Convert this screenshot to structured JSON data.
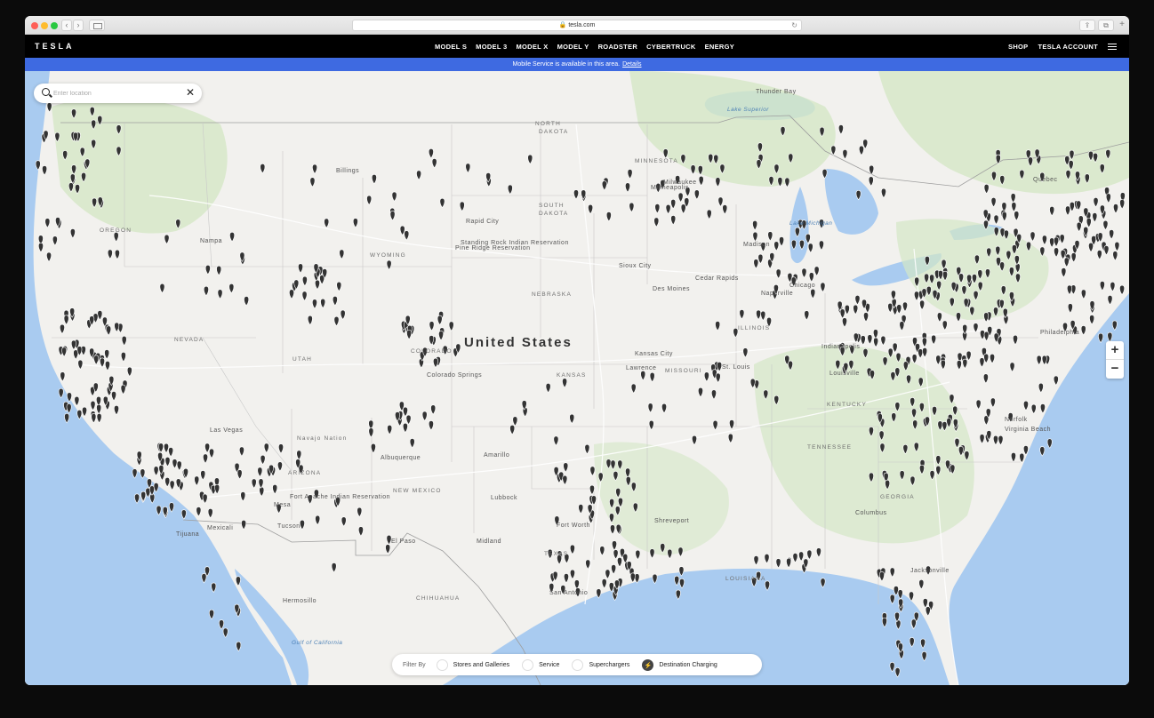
{
  "browser": {
    "url": "tesla.com",
    "reload_icon": "reload-icon",
    "back_glyph": "‹",
    "forward_glyph": "›",
    "share_glyph": "⇪",
    "tabs_glyph": "⧉",
    "newtab_glyph": "+"
  },
  "header": {
    "logo": "TESLA",
    "nav": [
      "MODEL S",
      "MODEL 3",
      "MODEL X",
      "MODEL Y",
      "ROADSTER",
      "CYBERTRUCK",
      "ENERGY"
    ],
    "shop": "SHOP",
    "account": "TESLA ACCOUNT"
  },
  "banner": {
    "text": "Mobile Service is available in this area.",
    "link": "Details"
  },
  "search": {
    "placeholder": "Enter location",
    "clear_glyph": "✕"
  },
  "zoom": {
    "in": "+",
    "out": "−"
  },
  "filter": {
    "label": "Filter By",
    "options": [
      {
        "label": "Stores and Galleries",
        "checked": false
      },
      {
        "label": "Service",
        "checked": false
      },
      {
        "label": "Superchargers",
        "checked": false
      },
      {
        "label": "Destination Charging",
        "checked": true,
        "icon": "bolt-icon"
      }
    ],
    "bolt_glyph": "⚡"
  },
  "map": {
    "country_label": "United States",
    "colors": {
      "land": "#f2f1ee",
      "water": "#a9cbf0",
      "forest": "#d4e7c6",
      "pin": "#333333"
    },
    "labels": [
      {
        "text": "NORTH",
        "type": "state"
      },
      {
        "text": "DAKOTA",
        "type": "state"
      },
      {
        "text": "SOUTH",
        "type": "state"
      },
      {
        "text": "DAKOTA",
        "type": "state"
      },
      {
        "text": "MINNESOTA",
        "type": "state"
      },
      {
        "text": "OREGON",
        "type": "state"
      },
      {
        "text": "WYOMING",
        "type": "state"
      },
      {
        "text": "NEBRASKA",
        "type": "state"
      },
      {
        "text": "NEVADA",
        "type": "state"
      },
      {
        "text": "KANSAS",
        "type": "state"
      },
      {
        "text": "MISSOURI",
        "type": "state"
      },
      {
        "text": "ILLINOIS",
        "type": "state"
      },
      {
        "text": "KENTUCKY",
        "type": "state"
      },
      {
        "text": "TENNESSEE",
        "type": "state"
      },
      {
        "text": "NEW MEXICO",
        "type": "state"
      },
      {
        "text": "ARIZONA",
        "type": "state"
      },
      {
        "text": "TEXAS",
        "type": "state"
      },
      {
        "text": "GEORGIA",
        "type": "state"
      },
      {
        "text": "LOUISIANA",
        "type": "state"
      },
      {
        "text": "CHIHUAHUA",
        "type": "state"
      },
      {
        "text": "UTAH",
        "type": "state"
      },
      {
        "text": "COLORADO",
        "type": "state"
      },
      {
        "text": "Lake Superior",
        "type": "water"
      },
      {
        "text": "Lake Michigan",
        "type": "water"
      },
      {
        "text": "Gulf of California",
        "type": "water"
      },
      {
        "text": "Las Vegas",
        "type": "city"
      },
      {
        "text": "Albuquerque",
        "type": "city"
      },
      {
        "text": "Fort Worth",
        "type": "city"
      },
      {
        "text": "Tucson",
        "type": "city"
      },
      {
        "text": "El Paso",
        "type": "city"
      },
      {
        "text": "San Antonio",
        "type": "city"
      },
      {
        "text": "Hermosillo",
        "type": "city"
      },
      {
        "text": "Louisville",
        "type": "city"
      },
      {
        "text": "Columbus",
        "type": "city"
      },
      {
        "text": "Jacksonville",
        "type": "city"
      },
      {
        "text": "Norfolk",
        "type": "city"
      },
      {
        "text": "Virginia Beach",
        "type": "city"
      },
      {
        "text": "Kansas City",
        "type": "city"
      },
      {
        "text": "St. Louis",
        "type": "city"
      },
      {
        "text": "Chicago",
        "type": "city"
      },
      {
        "text": "Des Moines",
        "type": "city"
      },
      {
        "text": "Minneapolis",
        "type": "city"
      },
      {
        "text": "Lubbock",
        "type": "city"
      },
      {
        "text": "Amarillo",
        "type": "city"
      },
      {
        "text": "Mesa",
        "type": "city"
      },
      {
        "text": "Mexicali",
        "type": "city"
      },
      {
        "text": "Tijuana",
        "type": "city"
      },
      {
        "text": "Billings",
        "type": "city"
      },
      {
        "text": "Nampa",
        "type": "city"
      },
      {
        "text": "Rapid City",
        "type": "city"
      },
      {
        "text": "Colorado Springs",
        "type": "city"
      },
      {
        "text": "Lawrence",
        "type": "city"
      },
      {
        "text": "Shreveport",
        "type": "city"
      },
      {
        "text": "Indianapolis",
        "type": "city"
      },
      {
        "text": "Midland",
        "type": "city"
      },
      {
        "text": "Thunder Bay",
        "type": "city"
      },
      {
        "text": "Quebec",
        "type": "city"
      },
      {
        "text": "Philadelphia",
        "type": "city"
      },
      {
        "text": "Cedar Rapids",
        "type": "city"
      },
      {
        "text": "Sioux City",
        "type": "city"
      },
      {
        "text": "Naperville",
        "type": "city"
      },
      {
        "text": "Madison",
        "type": "city"
      },
      {
        "text": "Milwaukee",
        "type": "city"
      },
      {
        "text": "Pine Ridge Reservation",
        "type": "city"
      },
      {
        "text": "Standing Rock Indian Reservation",
        "type": "city"
      },
      {
        "text": "Navajo Nation",
        "type": "state"
      },
      {
        "text": "Fort Apache Indian Reservation",
        "type": "city"
      }
    ]
  }
}
